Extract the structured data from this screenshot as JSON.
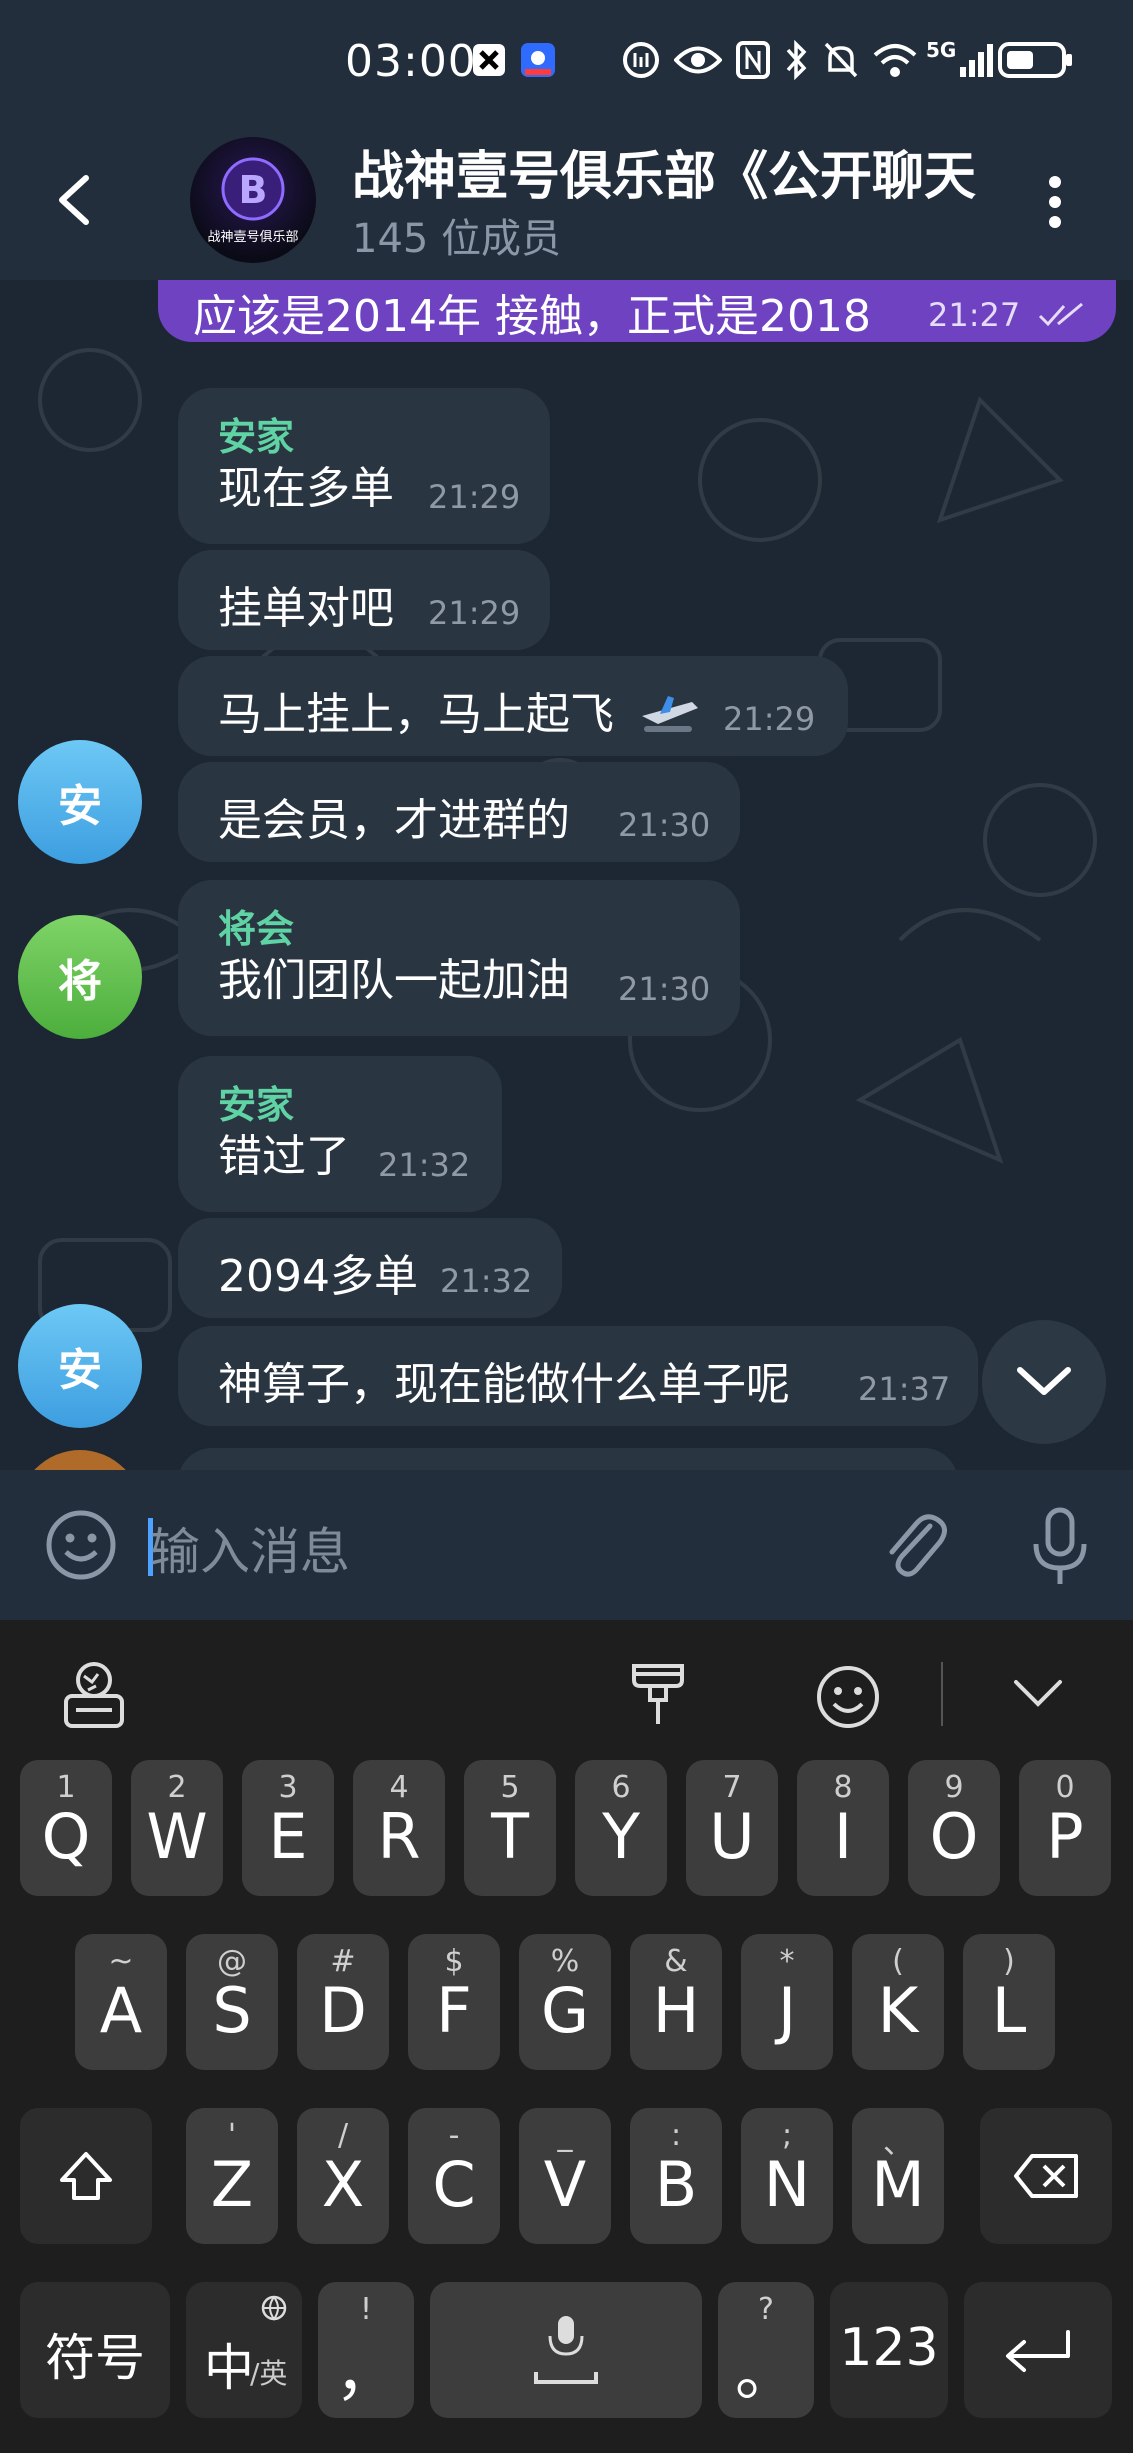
{
  "status_bar": {
    "time": "03:00",
    "signal_label": "5G"
  },
  "header": {
    "title": "战神壹号俱乐部《公开聊天",
    "subtitle": "145 位成员",
    "avatar_text": "战神壹号俱乐部"
  },
  "messages": [
    {
      "type": "out",
      "text": "应该是2014年 接触，正式是2018",
      "time": "21:27"
    },
    {
      "type": "in",
      "sender": "安家",
      "text": "现在多单",
      "time": "21:29"
    },
    {
      "type": "in",
      "text": "挂单对吧",
      "time": "21:29"
    },
    {
      "type": "in",
      "text": "马上挂上，马上起飞",
      "time": "21:29"
    },
    {
      "type": "in",
      "text": "是会员，才进群的",
      "time": "21:30",
      "avatar": "安"
    },
    {
      "type": "in",
      "sender": "将会",
      "text": "我们团队一起加油",
      "time": "21:30",
      "avatar": "将"
    },
    {
      "type": "in",
      "sender": "安家",
      "text": "错过了",
      "time": "21:32"
    },
    {
      "type": "in",
      "text": "2094多单",
      "time": "21:32"
    },
    {
      "type": "in",
      "text": "神算子，现在能做什么单子呢",
      "time": "21:37",
      "avatar": "安"
    }
  ],
  "input": {
    "placeholder": "输入消息"
  },
  "keyboard": {
    "row1": [
      {
        "main": "Q",
        "sub": "1"
      },
      {
        "main": "W",
        "sub": "2"
      },
      {
        "main": "E",
        "sub": "3"
      },
      {
        "main": "R",
        "sub": "4"
      },
      {
        "main": "T",
        "sub": "5"
      },
      {
        "main": "Y",
        "sub": "6"
      },
      {
        "main": "U",
        "sub": "7"
      },
      {
        "main": "I",
        "sub": "8"
      },
      {
        "main": "O",
        "sub": "9"
      },
      {
        "main": "P",
        "sub": "0"
      }
    ],
    "row2": [
      {
        "main": "A",
        "sub": "~"
      },
      {
        "main": "S",
        "sub": "@"
      },
      {
        "main": "D",
        "sub": "#"
      },
      {
        "main": "F",
        "sub": "$"
      },
      {
        "main": "G",
        "sub": "%"
      },
      {
        "main": "H",
        "sub": "&"
      },
      {
        "main": "J",
        "sub": "*"
      },
      {
        "main": "K",
        "sub": "("
      },
      {
        "main": "L",
        "sub": ")"
      }
    ],
    "row3": [
      {
        "main": "Z",
        "sub": "'"
      },
      {
        "main": "X",
        "sub": "/"
      },
      {
        "main": "C",
        "sub": "-"
      },
      {
        "main": "V",
        "sub": "_"
      },
      {
        "main": "B",
        "sub": ":"
      },
      {
        "main": "N",
        "sub": ";"
      },
      {
        "main": "M",
        "sub": "、"
      }
    ],
    "symbols_label": "符号",
    "lang_main": "中",
    "lang_sub": "/英",
    "comma_main": "，",
    "comma_sub": "!",
    "period_main": "。",
    "period_sub": "?",
    "num_label": "123"
  }
}
